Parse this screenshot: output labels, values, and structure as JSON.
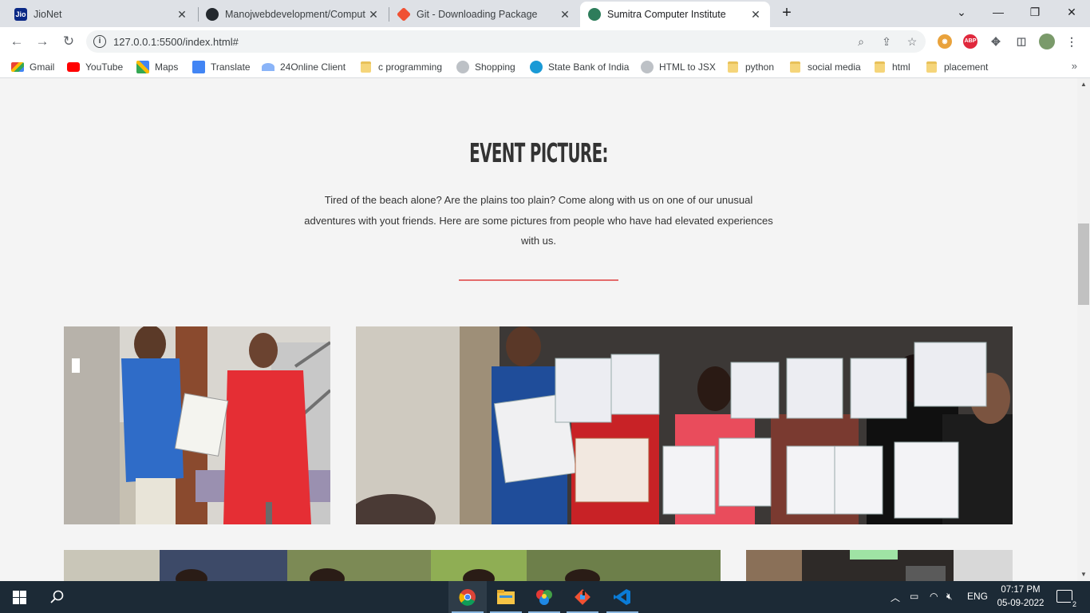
{
  "browser": {
    "tabs": [
      {
        "title": "JioNet",
        "favicon": "jio-icon",
        "active": false
      },
      {
        "title": "Manojwebdevelopment/Comput",
        "favicon": "github-icon",
        "active": false
      },
      {
        "title": "Git - Downloading Package",
        "favicon": "git-icon",
        "active": false
      },
      {
        "title": "Sumitra Computer Institute",
        "favicon": "site-icon",
        "active": true
      }
    ],
    "url": "127.0.0.1:5500/index.html#",
    "bookmarks": [
      {
        "label": "Gmail",
        "icon": "gmail-icon"
      },
      {
        "label": "YouTube",
        "icon": "youtube-icon"
      },
      {
        "label": "Maps",
        "icon": "maps-icon"
      },
      {
        "label": "Translate",
        "icon": "translate-icon"
      },
      {
        "label": "24Online Client",
        "icon": "24online-icon"
      },
      {
        "label": "c programming",
        "icon": "folder-icon"
      },
      {
        "label": "Shopping",
        "icon": "globe-icon"
      },
      {
        "label": "State Bank of India",
        "icon": "sbi-icon"
      },
      {
        "label": "HTML to JSX",
        "icon": "globe-icon"
      },
      {
        "label": "python",
        "icon": "folder-icon"
      },
      {
        "label": "social media",
        "icon": "folder-icon"
      },
      {
        "label": "html",
        "icon": "folder-icon"
      },
      {
        "label": "placement",
        "icon": "folder-icon"
      }
    ],
    "extensions": {
      "abp_label": "ABP"
    }
  },
  "page": {
    "heading": "EVENT PICTURE:",
    "lead": "Tired of the beach alone? Are the plains too plain? Come along with us on one of our unusual adventures with yout friends. Here are some pictures from people who have had elevated experiences with us.",
    "accent_color": "#e46b6b"
  },
  "taskbar": {
    "apps": [
      "chrome-icon",
      "file-explorer-icon",
      "paint-icon",
      "git-gui-icon",
      "vscode-icon"
    ],
    "language": "ENG",
    "time": "07:17 PM",
    "date": "05-09-2022",
    "notifications": "2"
  }
}
